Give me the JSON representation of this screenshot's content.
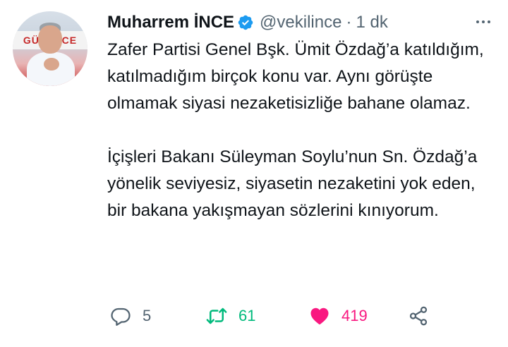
{
  "author": {
    "name": "Muharrem İNCE",
    "handle": "@vekilince",
    "separator": "·",
    "time": "1 dk",
    "avatar_banner_text": "GÜVENCE",
    "verified_color": "#1d9bf0"
  },
  "tweet": {
    "paragraphs": [
      "Zafer Partisi Genel Bşk. Ümit Özdağ’a katıldığım, katılmadığım birçok konu var. Aynı görüşte olmamak siyasi nezaketisizliğe bahane olamaz.",
      "İçişleri Bakanı Süleyman Soylu’nun Sn. Özdağ’a yönelik seviyesiz, siyasetin nezaketini yok eden, bir bakana yakışmayan sözlerini kınıyorum."
    ]
  },
  "actions": {
    "reply": {
      "icon": "reply-icon",
      "count": "5"
    },
    "retweet": {
      "icon": "retweet-icon",
      "count": "61",
      "color": "#00ba7c"
    },
    "like": {
      "icon": "heart-icon",
      "count": "419",
      "color": "#f91880"
    },
    "share": {
      "icon": "share-icon"
    }
  }
}
